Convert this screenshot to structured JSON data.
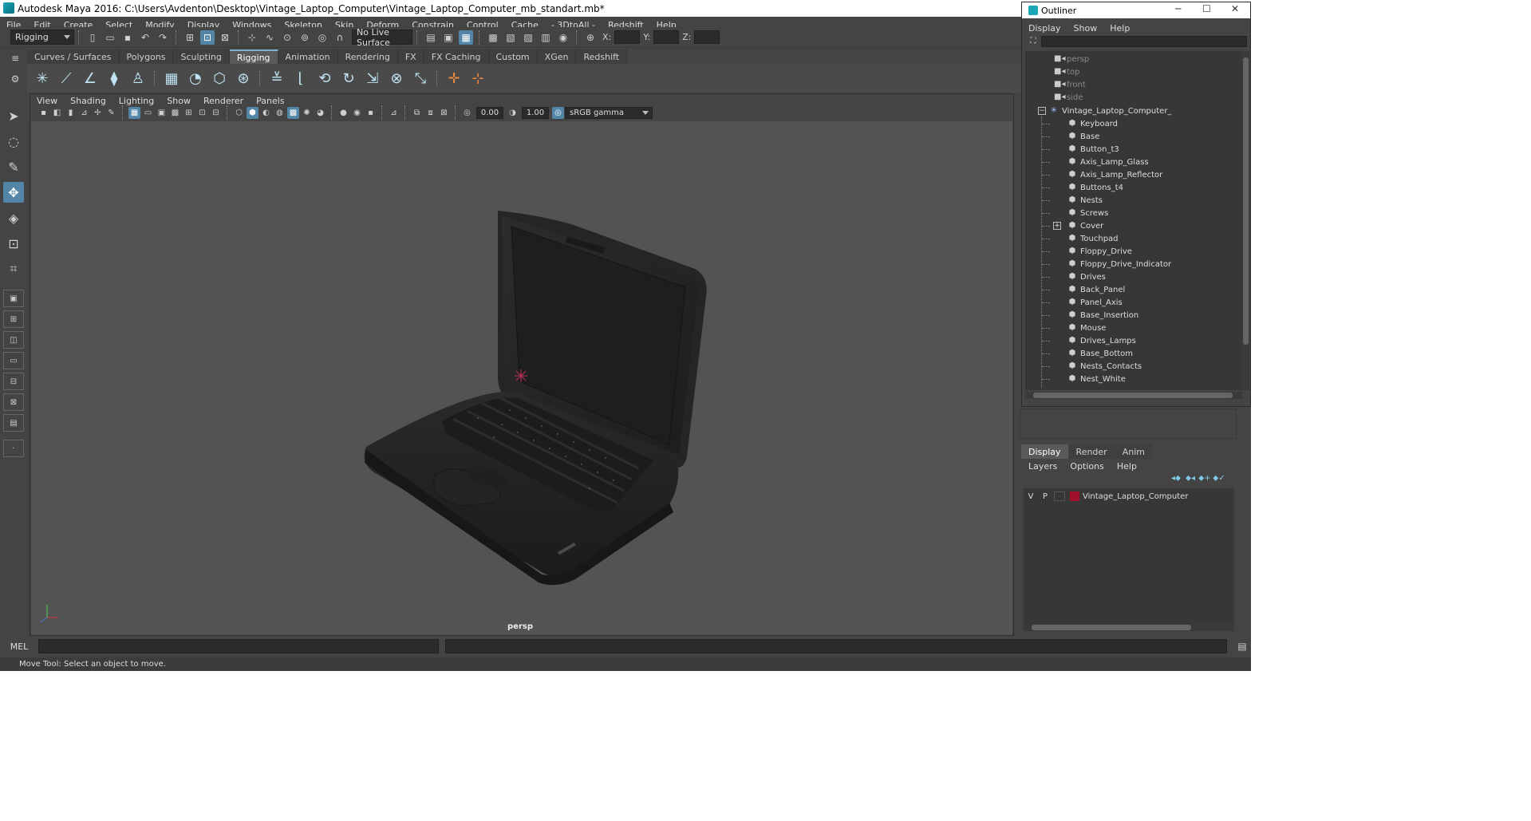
{
  "window": {
    "title": "Autodesk Maya 2016: C:\\Users\\Avdenton\\Desktop\\Vintage_Laptop_Computer\\Vintage_Laptop_Computer_mb_standart.mb*"
  },
  "menubar": [
    "File",
    "Edit",
    "Create",
    "Select",
    "Modify",
    "Display",
    "Windows",
    "Skeleton",
    "Skin",
    "Deform",
    "Constrain",
    "Control",
    "Cache",
    "- 3DtoAll -",
    "Redshift",
    "Help"
  ],
  "statusline": {
    "menuset": "Rigging",
    "live_surface": "No Live Surface",
    "x_label": "X:",
    "y_label": "Y:",
    "z_label": "Z:"
  },
  "shelf": {
    "tabs": [
      "Curves / Surfaces",
      "Polygons",
      "Sculpting",
      "Rigging",
      "Animation",
      "Rendering",
      "FX",
      "FX Caching",
      "Custom",
      "XGen",
      "Redshift"
    ],
    "active": "Rigging"
  },
  "viewport": {
    "menu": [
      "View",
      "Shading",
      "Lighting",
      "Show",
      "Renderer",
      "Panels"
    ],
    "exposure": "0.00",
    "gamma": "1.00",
    "colorspace": "sRGB gamma",
    "camera_label": "persp"
  },
  "commandline": {
    "mel_label": "MEL"
  },
  "helpline": {
    "text": "Move Tool: Select an object to move."
  },
  "outliner": {
    "title": "Outliner",
    "menu": [
      "Display",
      "Show",
      "Help"
    ],
    "cameras": [
      "persp",
      "top",
      "front",
      "side"
    ],
    "root": "Vintage_Laptop_Computer_",
    "children": [
      "Keyboard",
      "Base",
      "Button_t3",
      "Axis_Lamp_Glass",
      "Axis_Lamp_Reflector",
      "Buttons_t4",
      "Nests",
      "Screws",
      "Cover",
      "Touchpad",
      "Floppy_Drive",
      "Floppy_Drive_Indicator",
      "Drives",
      "Back_Panel",
      "Panel_Axis",
      "Base_Insertion",
      "Mouse",
      "Drives_Lamps",
      "Base_Bottom",
      "Nests_Contacts",
      "Nest_White"
    ]
  },
  "layer_editor": {
    "tabs": [
      "Display",
      "Render",
      "Anim"
    ],
    "active": "Display",
    "menu": [
      "Layers",
      "Options",
      "Help"
    ],
    "layer": {
      "v": "V",
      "p": "P",
      "name": "Vintage_Laptop_Computer",
      "color": "#a0102c"
    }
  }
}
